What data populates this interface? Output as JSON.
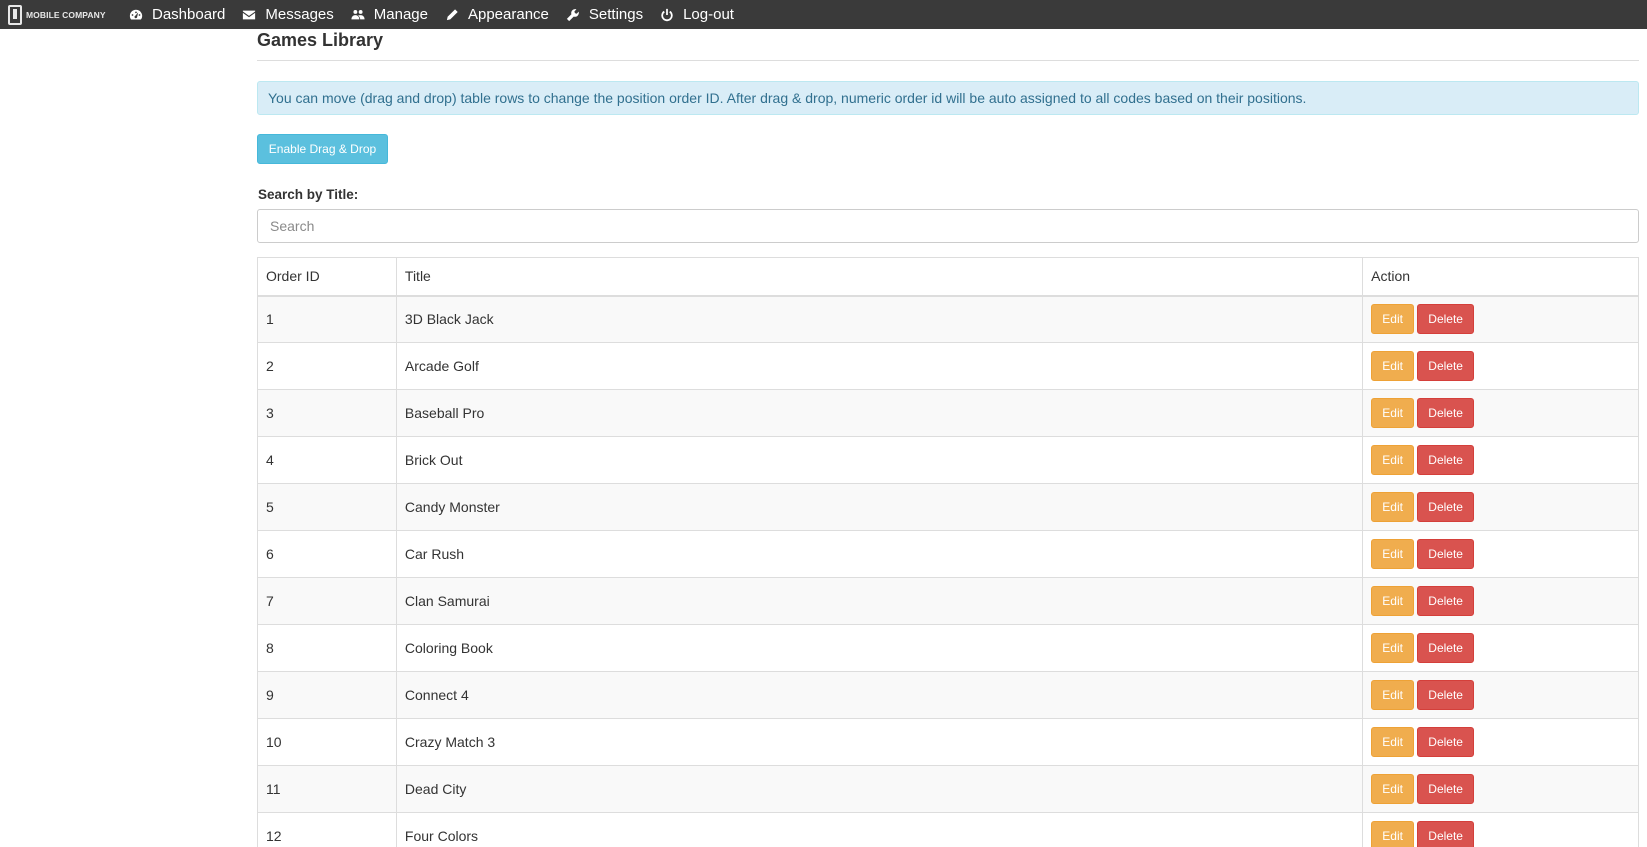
{
  "navbar": {
    "brand": "MOBILE COMPANY",
    "items": [
      {
        "label": "Dashboard",
        "icon": "dashboard-icon"
      },
      {
        "label": "Messages",
        "icon": "envelope-icon"
      },
      {
        "label": "Manage",
        "icon": "users-icon"
      },
      {
        "label": "Appearance",
        "icon": "pencil-icon"
      },
      {
        "label": "Settings",
        "icon": "wrench-icon"
      },
      {
        "label": "Log-out",
        "icon": "power-icon"
      }
    ]
  },
  "page": {
    "title": "Games Library",
    "alert": "You can move (drag and drop) table rows to change the position order ID. After drag & drop, numeric order id will be auto assigned to all codes based on their positions.",
    "drag_button": "Enable Drag & Drop",
    "search_label": "Search by Title:",
    "search_placeholder": "Search",
    "search_value": ""
  },
  "table": {
    "headers": [
      "Order ID",
      "Title",
      "Action"
    ],
    "edit_label": "Edit",
    "delete_label": "Delete",
    "rows": [
      {
        "id": "1",
        "title": "3D Black Jack"
      },
      {
        "id": "2",
        "title": "Arcade Golf"
      },
      {
        "id": "3",
        "title": "Baseball Pro"
      },
      {
        "id": "4",
        "title": "Brick Out"
      },
      {
        "id": "5",
        "title": "Candy Monster"
      },
      {
        "id": "6",
        "title": "Car Rush"
      },
      {
        "id": "7",
        "title": "Clan Samurai"
      },
      {
        "id": "8",
        "title": "Coloring Book"
      },
      {
        "id": "9",
        "title": "Connect 4"
      },
      {
        "id": "10",
        "title": "Crazy Match 3"
      },
      {
        "id": "11",
        "title": "Dead City"
      },
      {
        "id": "12",
        "title": "Four Colors"
      }
    ]
  },
  "colors": {
    "navbar": "#3a3a3a",
    "info": "#5bc0de",
    "alert_bg": "#d9edf7",
    "warning": "#f0ad4e",
    "danger": "#d9534f"
  }
}
